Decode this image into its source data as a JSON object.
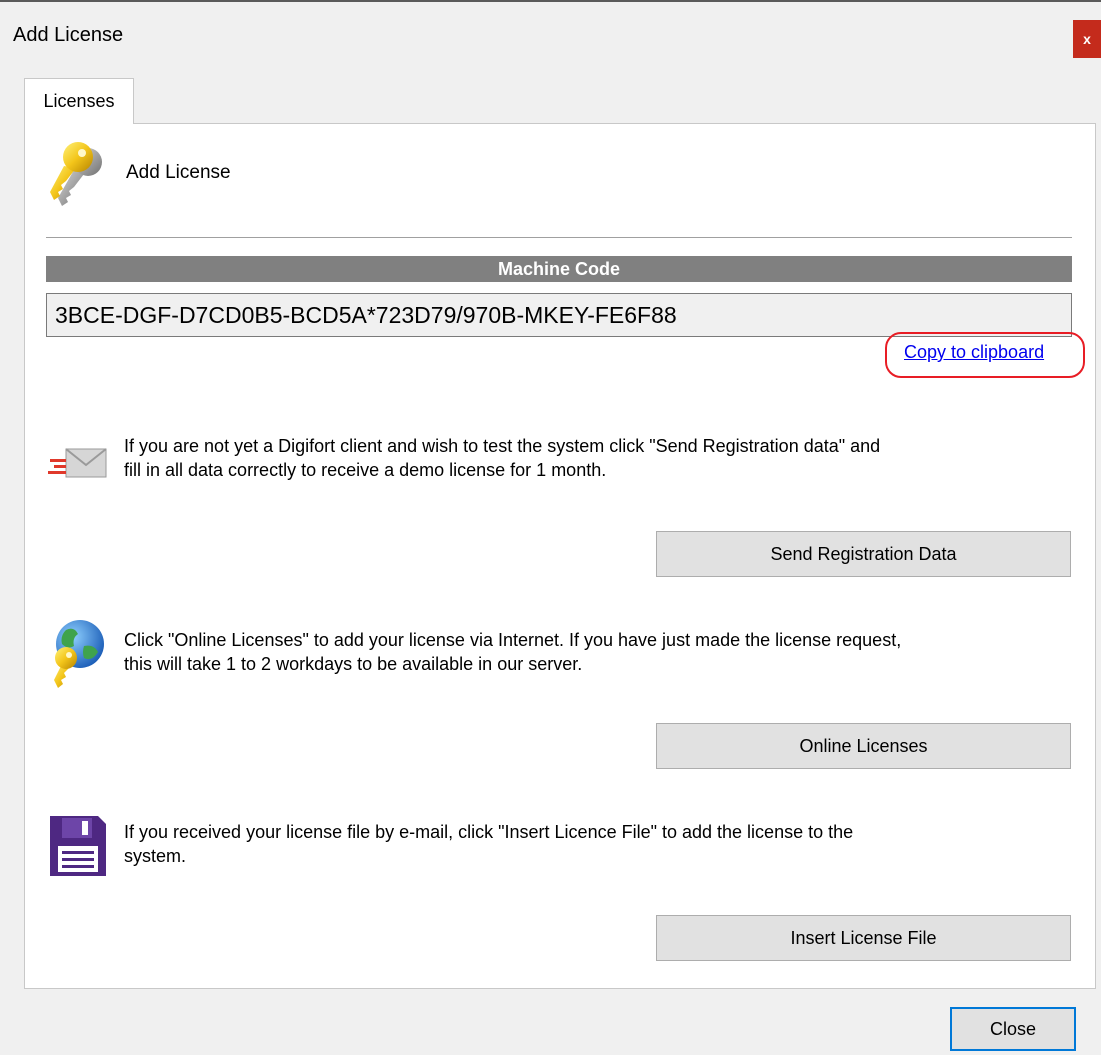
{
  "window": {
    "title": "Add License",
    "close_glyph": "x"
  },
  "tabs": [
    {
      "label": "Licenses"
    }
  ],
  "header": {
    "icon": "key-icon",
    "label": "Add License"
  },
  "machine_code": {
    "header": "Machine Code",
    "value": "3BCE-DGF-D7CD0B5-BCD5A*723D79/970B-MKEY-FE6F88",
    "copy_label": "Copy to clipboard"
  },
  "sections": {
    "registration": {
      "icon": "mail-icon",
      "line1": "If you are not yet a Digifort client and wish to test the system click \"Send Registration data\" and",
      "line2": "fill in all data correctly to receive a demo license for 1 month.",
      "button": "Send Registration Data"
    },
    "online": {
      "icon": "globe-key-icon",
      "line1": "Click \"Online Licenses\" to add your license via Internet. If you have just made the license request,",
      "line2": "this will take 1 to 2 workdays to be available in our server.",
      "button": "Online Licenses"
    },
    "file": {
      "icon": "floppy-disk-icon",
      "line1": "If you received your license file by e-mail, click \"Insert Licence File\" to add the license to the",
      "line2": "system.",
      "button": "Insert License File"
    }
  },
  "footer": {
    "close_label": "Close"
  },
  "colors": {
    "machine_code_header_bg": "#808080",
    "link": "#0000ee",
    "highlight_ring": "#e81d25",
    "close_title_button": "#c42b1c",
    "default_button_border": "#0078d7"
  }
}
